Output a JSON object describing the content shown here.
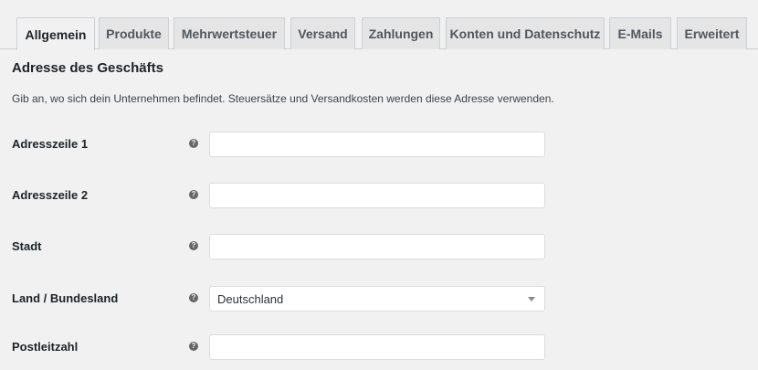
{
  "tabs": [
    {
      "label": "Allgemein",
      "active": true
    },
    {
      "label": "Produkte"
    },
    {
      "label": "Mehrwertsteuer"
    },
    {
      "label": "Versand"
    },
    {
      "label": "Zahlungen"
    },
    {
      "label": "Konten und Datenschutz"
    },
    {
      "label": "E-Mails"
    },
    {
      "label": "Erweitert"
    }
  ],
  "section": {
    "title": "Adresse des Geschäfts",
    "description": "Gib an, wo sich dein Unternehmen befindet. Steuersätze und Versandkosten werden diese Adresse verwenden."
  },
  "help_icon": "question-mark-icon",
  "fields": {
    "address1": {
      "label": "Adresszeile 1",
      "value": ""
    },
    "address2": {
      "label": "Adresszeile 2",
      "value": ""
    },
    "city": {
      "label": "Stadt",
      "value": ""
    },
    "country": {
      "label": "Land / Bundesland",
      "value": "Deutschland"
    },
    "postcode": {
      "label": "Postleitzahl",
      "value": ""
    }
  }
}
